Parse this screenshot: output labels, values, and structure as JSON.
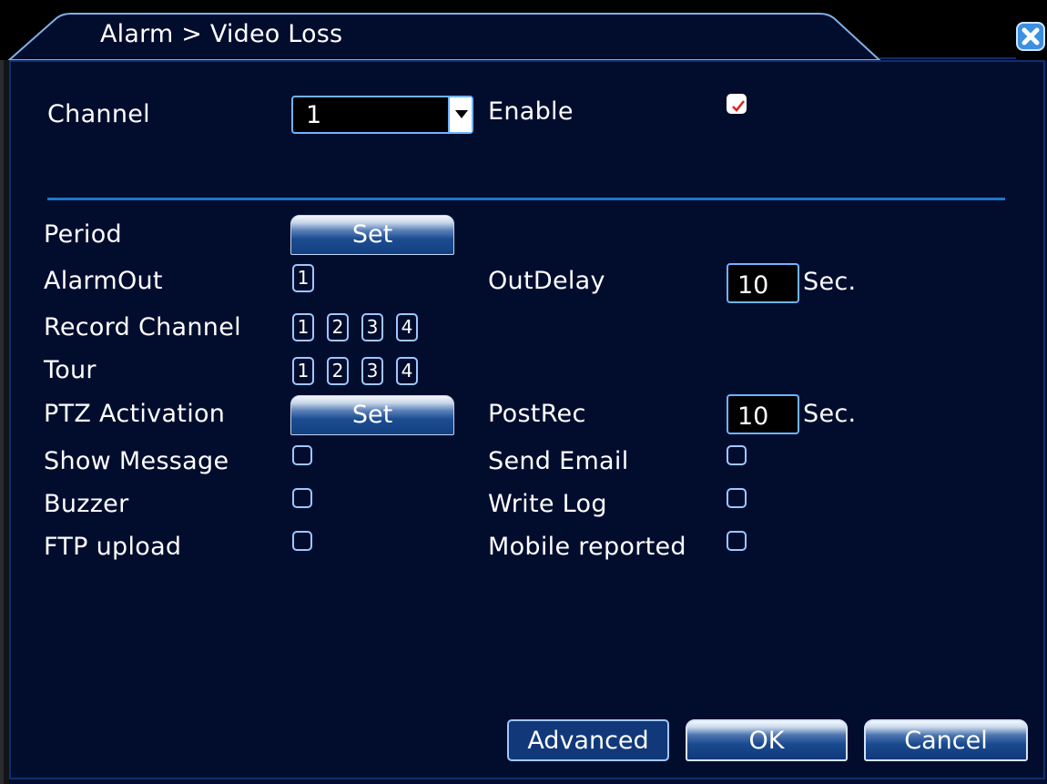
{
  "window": {
    "title": "Alarm > Video Loss"
  },
  "fields": {
    "channel_label": "Channel",
    "channel_value": "1",
    "enable_label": "Enable",
    "enable_checked": true,
    "period_label": "Period",
    "period_button": "Set",
    "alarmout_label": "AlarmOut",
    "alarmout_channels": [
      "1"
    ],
    "outdelay_label": "OutDelay",
    "outdelay_value": "10",
    "outdelay_unit": "Sec.",
    "record_channel_label": "Record Channel",
    "record_channels": [
      "1",
      "2",
      "3",
      "4"
    ],
    "tour_label": "Tour",
    "tour_channels": [
      "1",
      "2",
      "3",
      "4"
    ],
    "ptz_label": "PTZ Activation",
    "ptz_button": "Set",
    "postrec_label": "PostRec",
    "postrec_value": "10",
    "postrec_unit": "Sec.",
    "show_message_label": "Show Message",
    "send_email_label": "Send Email",
    "buzzer_label": "Buzzer",
    "write_log_label": "Write Log",
    "ftp_upload_label": "FTP upload",
    "mobile_reported_label": "Mobile reported"
  },
  "buttons": {
    "advanced": "Advanced",
    "ok": "OK",
    "cancel": "Cancel"
  },
  "icons": {
    "close": "close-icon",
    "dropdown": "chevron-down-icon",
    "check": "checkmark-icon"
  },
  "colors": {
    "background": "#020d2e",
    "accent": "#1b77c9",
    "checkmark": "#e0201b"
  }
}
